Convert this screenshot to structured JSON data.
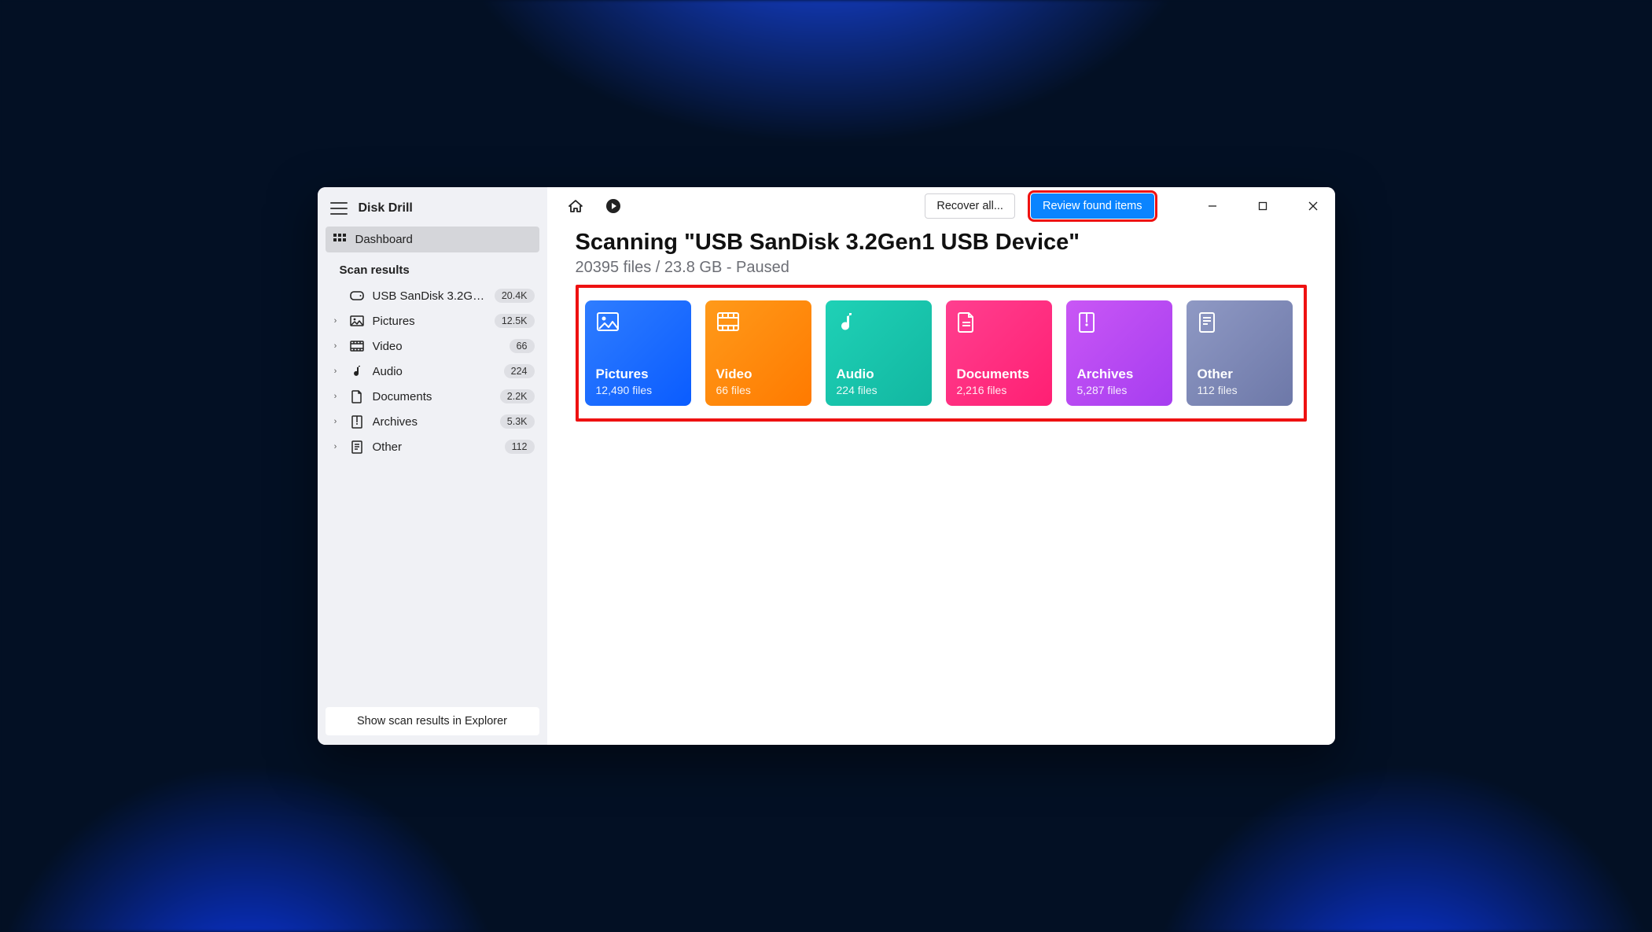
{
  "app": {
    "name": "Disk Drill"
  },
  "sidebar": {
    "dashboard": "Dashboard",
    "section": "Scan results",
    "device": {
      "label": "USB  SanDisk 3.2Gen1...",
      "badge": "20.4K"
    },
    "items": [
      {
        "label": "Pictures",
        "badge": "12.5K"
      },
      {
        "label": "Video",
        "badge": "66"
      },
      {
        "label": "Audio",
        "badge": "224"
      },
      {
        "label": "Documents",
        "badge": "2.2K"
      },
      {
        "label": "Archives",
        "badge": "5.3K"
      },
      {
        "label": "Other",
        "badge": "112"
      }
    ],
    "footer": "Show scan results in Explorer"
  },
  "topbar": {
    "recover": "Recover all...",
    "review": "Review found items"
  },
  "scan": {
    "title": "Scanning \"USB  SanDisk 3.2Gen1 USB Device\"",
    "subtitle": "20395 files / 23.8 GB - Paused"
  },
  "cards": {
    "pictures": {
      "name": "Pictures",
      "count": "12,490 files"
    },
    "video": {
      "name": "Video",
      "count": "66 files"
    },
    "audio": {
      "name": "Audio",
      "count": "224 files"
    },
    "documents": {
      "name": "Documents",
      "count": "2,216 files"
    },
    "archives": {
      "name": "Archives",
      "count": "5,287 files"
    },
    "other": {
      "name": "Other",
      "count": "112 files"
    }
  }
}
